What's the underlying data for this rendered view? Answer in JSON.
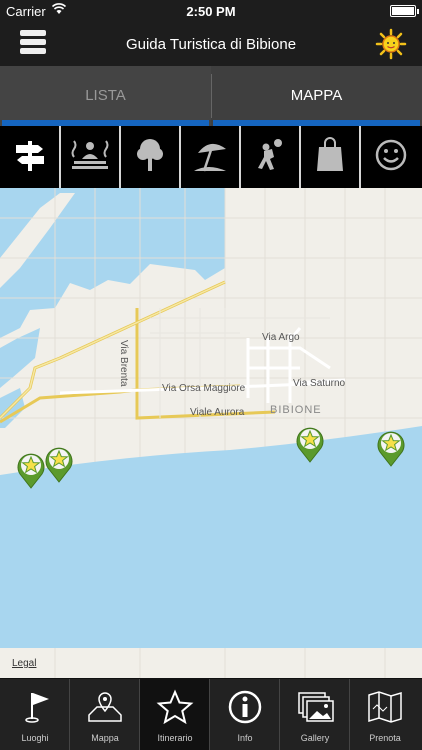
{
  "status_bar": {
    "carrier": "Carrier",
    "time": "2:50 PM"
  },
  "nav": {
    "title": "Guida Turistica di Bibione",
    "menu_icon": "menu-icon",
    "weather_icon": "sun-icon"
  },
  "segments": [
    {
      "label": "LISTA",
      "selected": false
    },
    {
      "label": "MAPPA",
      "selected": true
    }
  ],
  "categories": [
    {
      "name": "signpost-icon",
      "active": true
    },
    {
      "name": "spa-icon",
      "active": false
    },
    {
      "name": "tree-icon",
      "active": false
    },
    {
      "name": "beach-umbrella-icon",
      "active": false
    },
    {
      "name": "sport-icon",
      "active": false
    },
    {
      "name": "shopping-bag-icon",
      "active": false
    },
    {
      "name": "smiley-icon",
      "active": false
    }
  ],
  "map": {
    "streets": [
      "Via Argo",
      "Via Brenta",
      "Via Orsa Maggiore",
      "Via Saturno",
      "Viale Aurora"
    ],
    "city": "BIBIONE",
    "legal": "Legal",
    "colors": {
      "water": "#a8d6ef",
      "land": "#f1efe9",
      "road_major": "#f2d66b",
      "pin": "#5b9a2c",
      "star": "#f6e04a"
    }
  },
  "tabbar": [
    {
      "label": "Luoghi",
      "icon": "flag-pin-icon"
    },
    {
      "label": "Mappa",
      "icon": "map-icon"
    },
    {
      "label": "Itinerario",
      "icon": "star-icon"
    },
    {
      "label": "Info",
      "icon": "info-icon"
    },
    {
      "label": "Gallery",
      "icon": "gallery-icon"
    },
    {
      "label": "Prenota",
      "icon": "folded-map-icon"
    }
  ]
}
